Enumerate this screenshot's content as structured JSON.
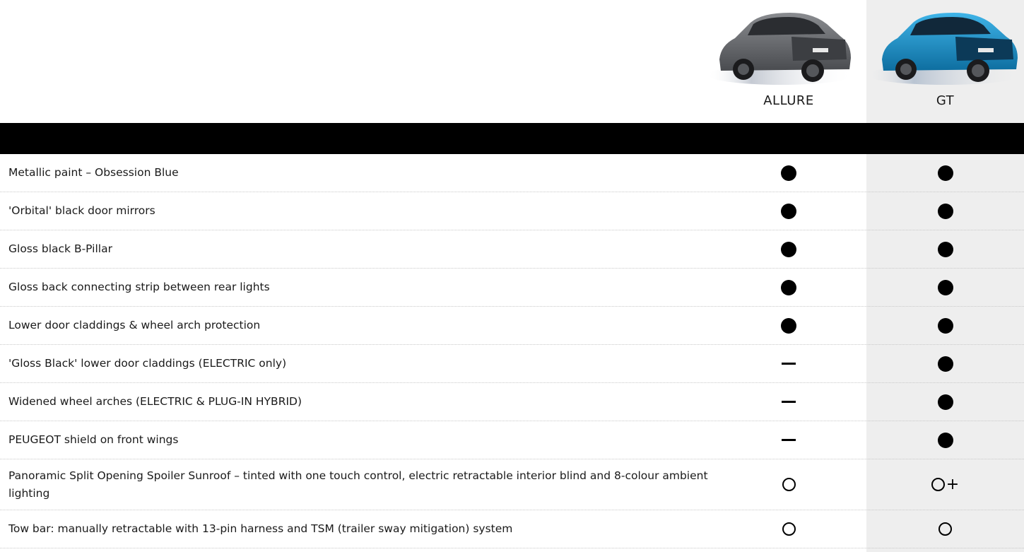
{
  "trims": {
    "allure": {
      "name": "ALLURE",
      "body_color": "#6b6d70"
    },
    "gt": {
      "name": "GT",
      "body_color": "#1e8ec9"
    }
  },
  "legend_icons": {
    "standard": "filled-circle-icon",
    "option": "open-circle-icon",
    "option_plus": "open-circle-plus-icon",
    "not_available": "dash-icon"
  },
  "rows": [
    {
      "label": "Metallic paint – Obsession Blue",
      "allure": "standard",
      "gt": "standard"
    },
    {
      "label": "'Orbital' black door mirrors",
      "allure": "standard",
      "gt": "standard"
    },
    {
      "label": "Gloss black B-Pillar",
      "allure": "standard",
      "gt": "standard"
    },
    {
      "label": "Gloss back connecting strip between rear lights",
      "allure": "standard",
      "gt": "standard"
    },
    {
      "label": "Lower door claddings & wheel arch protection",
      "allure": "standard",
      "gt": "standard"
    },
    {
      "label": "'Gloss Black' lower door claddings (ELECTRIC only)",
      "allure": "not_available",
      "gt": "standard"
    },
    {
      "label": "Widened wheel arches (ELECTRIC & PLUG-IN HYBRID)",
      "allure": "not_available",
      "gt": "standard"
    },
    {
      "label": "PEUGEOT shield on front wings",
      "allure": "not_available",
      "gt": "standard"
    },
    {
      "label": "Panoramic Split Opening Spoiler Sunroof – tinted with one touch control, electric retractable interior blind and 8-colour ambient lighting",
      "allure": "option",
      "gt": "option_plus"
    },
    {
      "label": "Tow bar: manually retractable with 13-pin harness and TSM (trailer sway mitigation) system",
      "allure": "option",
      "gt": "option"
    }
  ],
  "colors": {
    "band": "#000000",
    "gt_column": "#eeeeee",
    "divider": "#c9c9c9"
  }
}
